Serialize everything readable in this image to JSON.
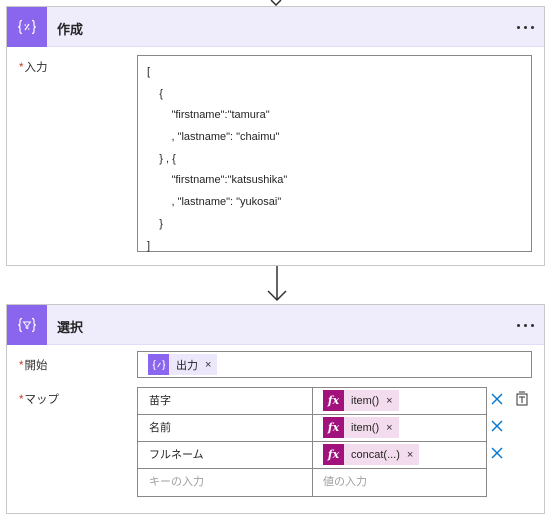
{
  "compose": {
    "title": "作成",
    "input_label": "入力",
    "required_mark": "*",
    "input_lines": [
      "[",
      "    {",
      "        \"firstname\":\"tamura\"",
      "        , \"lastname\": \"chaimu\"",
      "    } , {",
      "        \"firstname\":\"katsushika\"",
      "        , \"lastname\": \"yukosai\"",
      "    }",
      "]"
    ]
  },
  "select": {
    "title": "選択",
    "from_label": "開始",
    "map_label": "マップ",
    "required_mark": "*",
    "from_token": "出力",
    "rows": [
      {
        "key": "苗字",
        "value": "item()"
      },
      {
        "key": "名前",
        "value": "item()"
      },
      {
        "key": "フルネーム",
        "value": "concat(...)"
      }
    ],
    "key_placeholder": "キーの入力",
    "value_placeholder": "値の入力",
    "remove_mark": "×",
    "fx_mark": "fx"
  },
  "colors": {
    "accent": "#8a66ee",
    "header_bg": "#efecfc",
    "expression_token": "#a1127d",
    "delete_icon": "#0078d4"
  },
  "icons": {
    "action": "curly-braces-icon",
    "select_action": "curly-braces-filter-icon",
    "more": "more-options-icon",
    "arrow": "down-arrow-icon",
    "delete": "close-icon",
    "switch_mode": "text-mode-icon"
  }
}
